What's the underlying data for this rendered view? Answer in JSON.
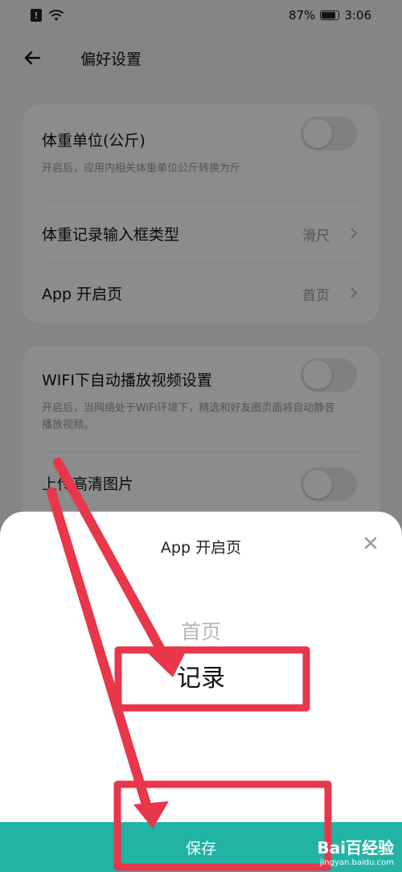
{
  "status": {
    "battery": "87%",
    "time": "3:06",
    "battery_level": 0.87,
    "sim_alert": "!"
  },
  "header": {
    "title": "偏好设置"
  },
  "settings_card1": {
    "weight_unit": {
      "title": "体重单位(公斤)",
      "desc": "开启后，应用内相关体重单位公斤转换为斤",
      "enabled": false
    },
    "input_type": {
      "title": "体重记录输入框类型",
      "value": "滑尺"
    },
    "app_start": {
      "title": "App 开启页",
      "value": "首页"
    }
  },
  "settings_card2": {
    "wifi_autoplay": {
      "title": "WIFI下自动播放视频设置",
      "desc": "开启后，当网络处于WiFi环境下，精选和好友圈页面将自动静音播放视频。",
      "enabled": false
    },
    "hd_upload": {
      "title": "上传高清图片",
      "enabled": false
    }
  },
  "sheet": {
    "title": "App 开启页",
    "options": [
      "首页",
      "记录"
    ],
    "selected": "记录",
    "save_label": "保存"
  },
  "colors": {
    "accent": "#21b3a4",
    "annotation": "#e8364a"
  },
  "watermark": {
    "logo": "Bai百经验",
    "sub": "jingyan.baidu.com"
  }
}
